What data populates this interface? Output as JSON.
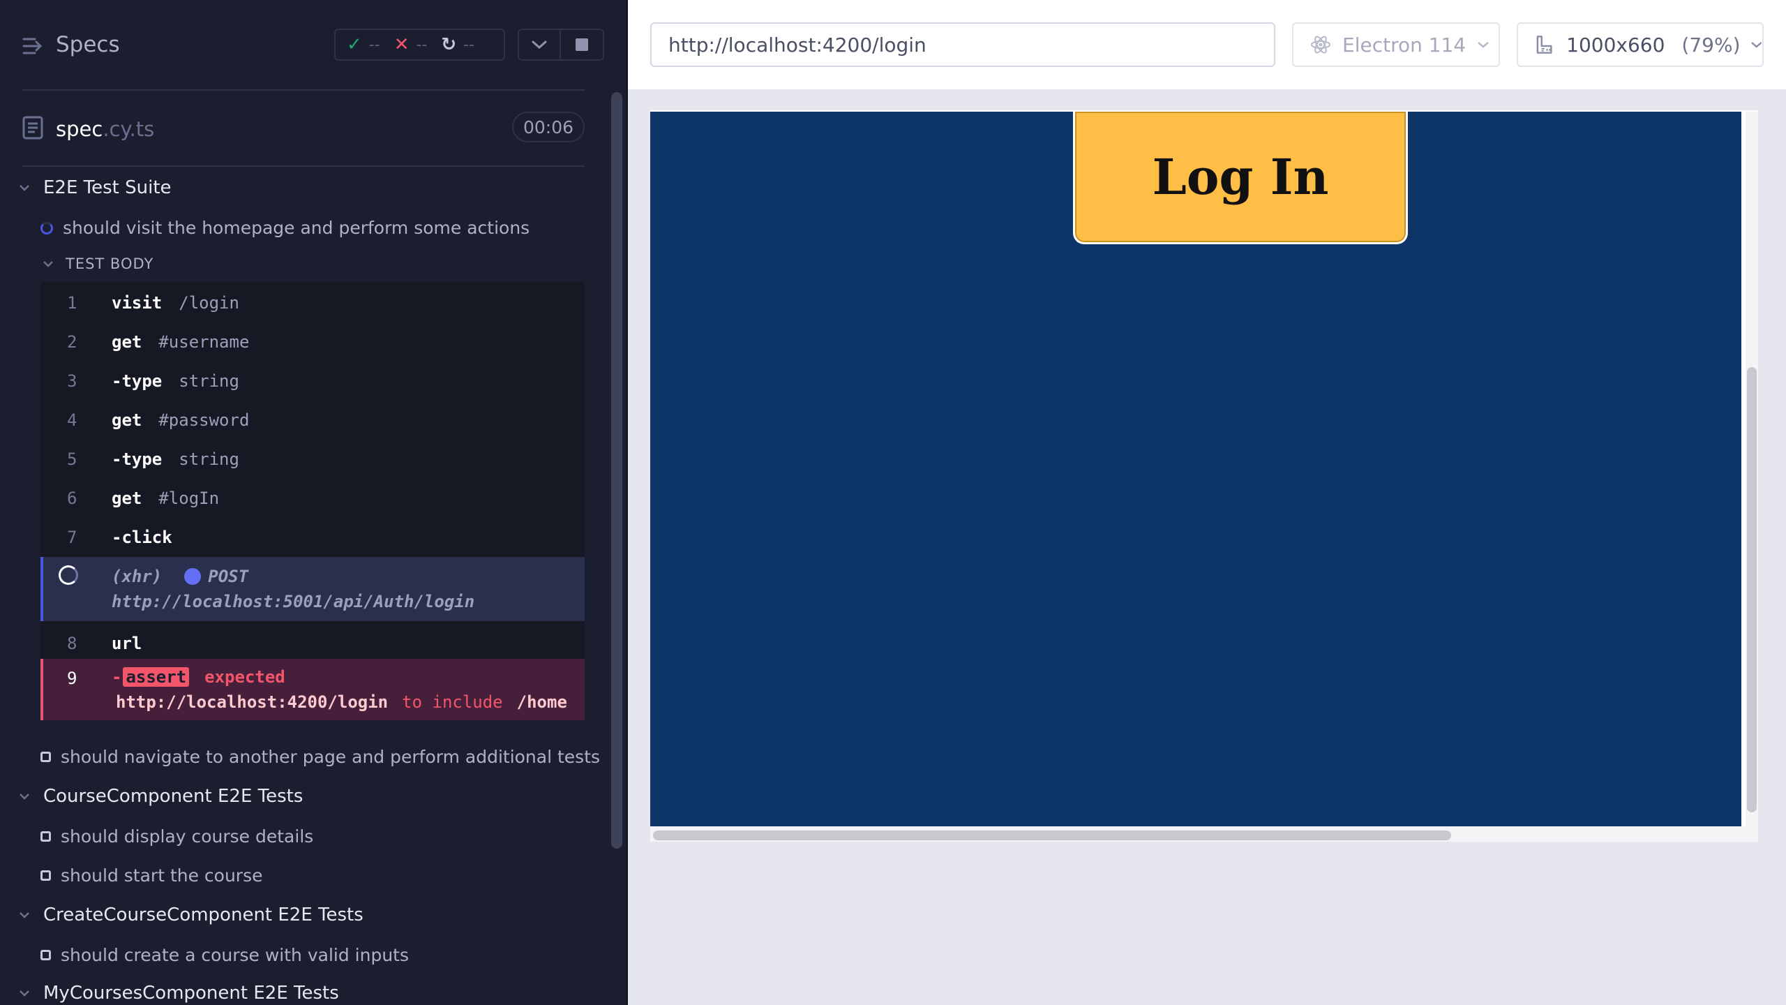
{
  "reporter": {
    "title": "Specs",
    "stats": {
      "passed": "--",
      "failed": "--",
      "pending": "--"
    },
    "spec": {
      "name": "spec",
      "ext": ".cy.ts",
      "timer": "00:06"
    },
    "suites": [
      {
        "title": "E2E Test Suite",
        "tests": [
          {
            "title": "should visit the homepage and perform some actions",
            "state": "running"
          },
          {
            "title": "should navigate to another page and perform additional tests",
            "state": "pending"
          }
        ]
      },
      {
        "title": "CourseComponent E2E Tests",
        "tests": [
          {
            "title": "should display course details",
            "state": "pending"
          },
          {
            "title": "should start the course",
            "state": "pending"
          }
        ]
      },
      {
        "title": "CreateCourseComponent E2E Tests",
        "tests": [
          {
            "title": "should create a course with valid inputs",
            "state": "pending"
          }
        ]
      },
      {
        "title": "MyCoursesComponent E2E Tests",
        "tests": []
      }
    ],
    "test_body_label": "TEST BODY",
    "commands": [
      {
        "num": "1",
        "name": "visit",
        "msg": "/login"
      },
      {
        "num": "2",
        "name": "get",
        "msg": "#username"
      },
      {
        "num": "3",
        "name": "-type",
        "msg": "string"
      },
      {
        "num": "4",
        "name": "get",
        "msg": "#password"
      },
      {
        "num": "5",
        "name": "-type",
        "msg": "string"
      },
      {
        "num": "6",
        "name": "get",
        "msg": "#logIn"
      },
      {
        "num": "7",
        "name": "-click",
        "msg": ""
      },
      {
        "num": "8",
        "name": "url",
        "msg": ""
      }
    ],
    "xhr": {
      "type": "(xhr)",
      "method": "POST",
      "url": "http://localhost:5001/api/Auth/login"
    },
    "assert": {
      "num": "9",
      "badge": "assert",
      "expected": "expected",
      "actual": "http://localhost:4200/login",
      "keyword": "to include",
      "target": "/home"
    }
  },
  "preview": {
    "url": "http://localhost:4200/login",
    "browser": "Electron 114",
    "viewport": "1000x660",
    "viewport_scale": "(79%)",
    "app": {
      "login_button": "Log In"
    }
  },
  "colors": {
    "reporter_bg": "#1b1e2e",
    "pass": "#1fa971",
    "fail": "#f3556b",
    "running": "#4956e3",
    "app_bg": "#0e3567",
    "login_button": "#ffbf47"
  }
}
